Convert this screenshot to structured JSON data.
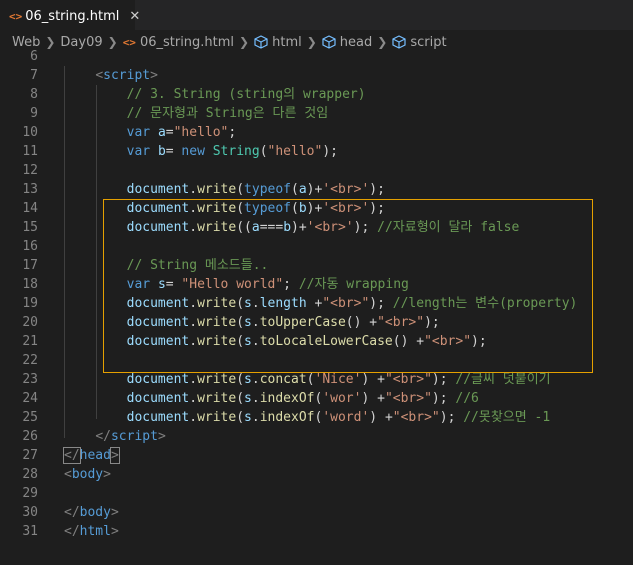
{
  "tab": {
    "icon": "<>",
    "label": "06_string.html",
    "close": "✕"
  },
  "breadcrumb": [
    "Web",
    "Day09",
    "06_string.html",
    "html",
    "head",
    "script"
  ],
  "icons": {
    "file": "html-file-icon",
    "element": "cube-icon",
    "separator": "chevron-right-icon"
  },
  "colors": {
    "accent": "#e5a000",
    "tag": "#569cd6",
    "comment": "#6a9955",
    "string": "#ce9178",
    "function": "#dcdcaa",
    "variable": "#9cdcfe",
    "class": "#4ec9b0"
  },
  "lines": [
    {
      "n": "6",
      "tokens": []
    },
    {
      "n": "7",
      "tokens": [
        [
          "pl",
          "    "
        ],
        [
          "br",
          "<"
        ],
        [
          "tag",
          "script"
        ],
        [
          "br",
          ">"
        ]
      ]
    },
    {
      "n": "8",
      "tokens": [
        [
          "pl",
          "        "
        ],
        [
          "cm",
          "// 3. String (string의 wrapper)"
        ]
      ]
    },
    {
      "n": "9",
      "tokens": [
        [
          "pl",
          "        "
        ],
        [
          "cm",
          "// 문자형과 String은 다른 것임"
        ]
      ]
    },
    {
      "n": "10",
      "tokens": [
        [
          "pl",
          "        "
        ],
        [
          "kw",
          "var"
        ],
        [
          "pl",
          " "
        ],
        [
          "id",
          "a"
        ],
        [
          "pl",
          "="
        ],
        [
          "str",
          "\"hello\""
        ],
        [
          "pl",
          ";"
        ]
      ]
    },
    {
      "n": "11",
      "tokens": [
        [
          "pl",
          "        "
        ],
        [
          "kw",
          "var"
        ],
        [
          "pl",
          " "
        ],
        [
          "id",
          "b"
        ],
        [
          "pl",
          "= "
        ],
        [
          "kw",
          "new"
        ],
        [
          "pl",
          " "
        ],
        [
          "cls",
          "String"
        ],
        [
          "pl",
          "("
        ],
        [
          "str",
          "\"hello\""
        ],
        [
          "pl",
          ");"
        ]
      ]
    },
    {
      "n": "12",
      "tokens": []
    },
    {
      "n": "13",
      "tokens": [
        [
          "pl",
          "        "
        ],
        [
          "id",
          "document"
        ],
        [
          "pl",
          "."
        ],
        [
          "fn",
          "write"
        ],
        [
          "pl",
          "("
        ],
        [
          "kw",
          "typeof"
        ],
        [
          "pl",
          "("
        ],
        [
          "id",
          "a"
        ],
        [
          "pl",
          ")+"
        ],
        [
          "str",
          "'<br>'"
        ],
        [
          "pl",
          ");"
        ]
      ]
    },
    {
      "n": "14",
      "tokens": [
        [
          "pl",
          "        "
        ],
        [
          "id",
          "document"
        ],
        [
          "pl",
          "."
        ],
        [
          "fn",
          "write"
        ],
        [
          "pl",
          "("
        ],
        [
          "kw",
          "typeof"
        ],
        [
          "pl",
          "("
        ],
        [
          "id",
          "b"
        ],
        [
          "pl",
          ")+"
        ],
        [
          "str",
          "'<br>'"
        ],
        [
          "pl",
          ");"
        ]
      ]
    },
    {
      "n": "15",
      "tokens": [
        [
          "pl",
          "        "
        ],
        [
          "id",
          "document"
        ],
        [
          "pl",
          "."
        ],
        [
          "fn",
          "write"
        ],
        [
          "pl",
          "(("
        ],
        [
          "id",
          "a"
        ],
        [
          "pl",
          "==="
        ],
        [
          "id",
          "b"
        ],
        [
          "pl",
          ")+"
        ],
        [
          "str",
          "'<br>'"
        ],
        [
          "pl",
          "); "
        ],
        [
          "cm",
          "//자료형이 달라 false"
        ]
      ]
    },
    {
      "n": "16",
      "tokens": []
    },
    {
      "n": "17",
      "tokens": [
        [
          "pl",
          "        "
        ],
        [
          "cm",
          "// String 메소드들.."
        ]
      ]
    },
    {
      "n": "18",
      "tokens": [
        [
          "pl",
          "        "
        ],
        [
          "kw",
          "var"
        ],
        [
          "pl",
          " "
        ],
        [
          "id",
          "s"
        ],
        [
          "pl",
          "= "
        ],
        [
          "str",
          "\"Hello world\""
        ],
        [
          "pl",
          "; "
        ],
        [
          "cm",
          "//자동 wrapping"
        ]
      ]
    },
    {
      "n": "19",
      "tokens": [
        [
          "pl",
          "        "
        ],
        [
          "id",
          "document"
        ],
        [
          "pl",
          "."
        ],
        [
          "fn",
          "write"
        ],
        [
          "pl",
          "("
        ],
        [
          "id",
          "s"
        ],
        [
          "pl",
          "."
        ],
        [
          "id",
          "length"
        ],
        [
          "pl",
          " +"
        ],
        [
          "str",
          "\"<br>\""
        ],
        [
          "pl",
          "); "
        ],
        [
          "cm",
          "//length는 변수(property)"
        ]
      ]
    },
    {
      "n": "20",
      "tokens": [
        [
          "pl",
          "        "
        ],
        [
          "id",
          "document"
        ],
        [
          "pl",
          "."
        ],
        [
          "fn",
          "write"
        ],
        [
          "pl",
          "("
        ],
        [
          "id",
          "s"
        ],
        [
          "pl",
          "."
        ],
        [
          "fn",
          "toUpperCase"
        ],
        [
          "pl",
          "() +"
        ],
        [
          "str",
          "\"<br>\""
        ],
        [
          "pl",
          ");"
        ]
      ]
    },
    {
      "n": "21",
      "tokens": [
        [
          "pl",
          "        "
        ],
        [
          "id",
          "document"
        ],
        [
          "pl",
          "."
        ],
        [
          "fn",
          "write"
        ],
        [
          "pl",
          "("
        ],
        [
          "id",
          "s"
        ],
        [
          "pl",
          "."
        ],
        [
          "fn",
          "toLocaleLowerCase"
        ],
        [
          "pl",
          "() +"
        ],
        [
          "str",
          "\"<br>\""
        ],
        [
          "pl",
          ");"
        ]
      ]
    },
    {
      "n": "22",
      "tokens": []
    },
    {
      "n": "23",
      "tokens": [
        [
          "pl",
          "        "
        ],
        [
          "id",
          "document"
        ],
        [
          "pl",
          "."
        ],
        [
          "fn",
          "write"
        ],
        [
          "pl",
          "("
        ],
        [
          "id",
          "s"
        ],
        [
          "pl",
          "."
        ],
        [
          "fn",
          "concat"
        ],
        [
          "pl",
          "("
        ],
        [
          "str",
          "'Nice'"
        ],
        [
          "pl",
          ") +"
        ],
        [
          "str",
          "\"<br>\""
        ],
        [
          "pl",
          "); "
        ],
        [
          "cm",
          "//글씨 덧붙이기"
        ]
      ]
    },
    {
      "n": "24",
      "tokens": [
        [
          "pl",
          "        "
        ],
        [
          "id",
          "document"
        ],
        [
          "pl",
          "."
        ],
        [
          "fn",
          "write"
        ],
        [
          "pl",
          "("
        ],
        [
          "id",
          "s"
        ],
        [
          "pl",
          "."
        ],
        [
          "fn",
          "indexOf"
        ],
        [
          "pl",
          "("
        ],
        [
          "str",
          "'wor'"
        ],
        [
          "pl",
          ") +"
        ],
        [
          "str",
          "\"<br>\""
        ],
        [
          "pl",
          "); "
        ],
        [
          "cm",
          "//6"
        ]
      ]
    },
    {
      "n": "25",
      "tokens": [
        [
          "pl",
          "        "
        ],
        [
          "id",
          "document"
        ],
        [
          "pl",
          "."
        ],
        [
          "fn",
          "write"
        ],
        [
          "pl",
          "("
        ],
        [
          "id",
          "s"
        ],
        [
          "pl",
          "."
        ],
        [
          "fn",
          "indexOf"
        ],
        [
          "pl",
          "("
        ],
        [
          "str",
          "'word'"
        ],
        [
          "pl",
          ") +"
        ],
        [
          "str",
          "\"<br>\""
        ],
        [
          "pl",
          "); "
        ],
        [
          "cm",
          "//못찾으면 -1"
        ]
      ]
    },
    {
      "n": "26",
      "tokens": [
        [
          "pl",
          "    "
        ],
        [
          "br",
          "</"
        ],
        [
          "tag",
          "script"
        ],
        [
          "br",
          ">"
        ]
      ]
    },
    {
      "n": "27",
      "tokens": [
        [
          "bm",
          "</"
        ],
        [
          "tag",
          "head"
        ],
        [
          "bm",
          ">"
        ]
      ]
    },
    {
      "n": "28",
      "tokens": [
        [
          "br",
          "<"
        ],
        [
          "tag",
          "body"
        ],
        [
          "br",
          ">"
        ]
      ]
    },
    {
      "n": "29",
      "tokens": []
    },
    {
      "n": "30",
      "tokens": [
        [
          "br",
          "</"
        ],
        [
          "tag",
          "body"
        ],
        [
          "br",
          ">"
        ]
      ]
    },
    {
      "n": "31",
      "tokens": [
        [
          "br",
          "</"
        ],
        [
          "tag",
          "html"
        ],
        [
          "br",
          ">"
        ]
      ]
    }
  ]
}
